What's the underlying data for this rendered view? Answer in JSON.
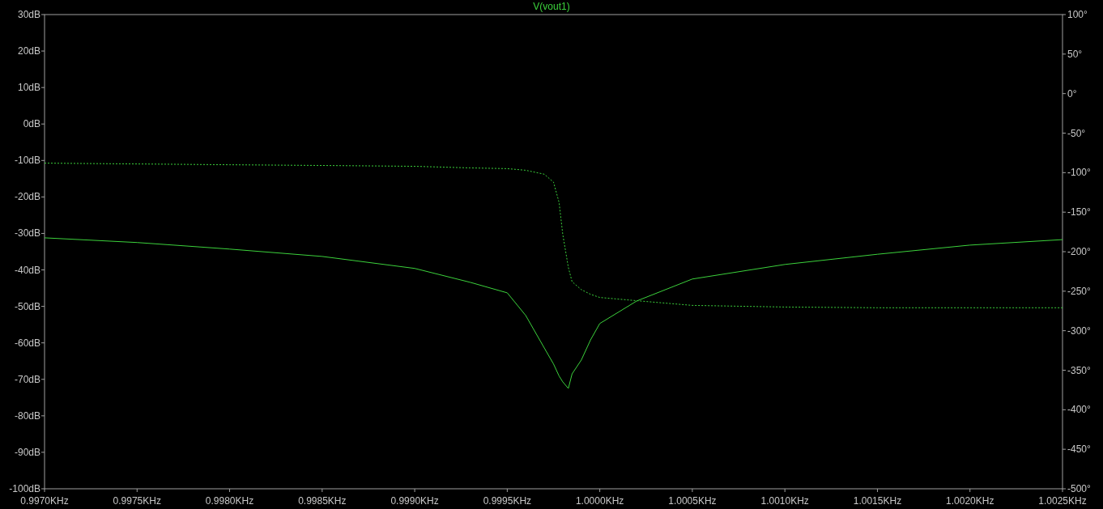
{
  "plot": {
    "chart_data": {
      "type": "line",
      "title": "V(vout1)",
      "x": [
        0.997,
        0.9975,
        0.998,
        0.9985,
        0.999,
        0.9993,
        0.9995,
        0.9996,
        0.9997,
        0.99975,
        0.99978,
        0.9998,
        0.99983,
        0.99985,
        0.9999,
        0.99995,
        1.0,
        1.0002,
        1.0005,
        1.001,
        1.0015,
        1.002,
        1.0025
      ],
      "series": [
        {
          "color": "#3cd23c",
          "line_style": "solid",
          "values": [
            -31.2,
            -32.5,
            -34.3,
            -36.3,
            -39.6,
            -43.4,
            -46.3,
            -52.5,
            -61.4,
            -65.8,
            -69.1,
            -70.7,
            -72.5,
            -68.5,
            -64.7,
            -59.2,
            -54.7,
            -48.5,
            -42.5,
            -38.5,
            -35.7,
            -33.2,
            -31.7
          ]
        },
        {
          "color": "#3cd23c",
          "axis": "y2",
          "line_style": "dashed",
          "values": [
            -88,
            -89,
            -90,
            -91,
            -92,
            -94,
            -95,
            -97,
            -102,
            -112,
            -138,
            -178,
            -220,
            -238,
            -248,
            -254,
            -258,
            -262,
            -268,
            -270,
            -271,
            -271,
            -271
          ]
        }
      ],
      "xlim": [
        0.997,
        1.0025
      ],
      "ylim": [
        -100,
        30
      ],
      "y2lim": [
        -500,
        100
      ],
      "xticks": [
        {
          "value": 0.997,
          "label": "0.9970KHz"
        },
        {
          "value": 0.9975,
          "label": "0.9975KHz"
        },
        {
          "value": 0.998,
          "label": "0.9980KHz"
        },
        {
          "value": 0.9985,
          "label": "0.9985KHz"
        },
        {
          "value": 0.999,
          "label": "0.9990KHz"
        },
        {
          "value": 0.9995,
          "label": "0.9995KHz"
        },
        {
          "value": 1.0,
          "label": "1.0000KHz"
        },
        {
          "value": 1.0005,
          "label": "1.0005KHz"
        },
        {
          "value": 1.001,
          "label": "1.0010KHz"
        },
        {
          "value": 1.0015,
          "label": "1.0015KHz"
        },
        {
          "value": 1.002,
          "label": "1.0020KHz"
        },
        {
          "value": 1.0025,
          "label": "1.0025KHz"
        }
      ],
      "yticks": [
        {
          "value": 30,
          "label": "30dB"
        },
        {
          "value": 20,
          "label": "20dB"
        },
        {
          "value": 10,
          "label": "10dB"
        },
        {
          "value": 0,
          "label": "0dB"
        },
        {
          "value": -10,
          "label": "-10dB"
        },
        {
          "value": -20,
          "label": "-20dB"
        },
        {
          "value": -30,
          "label": "-30dB"
        },
        {
          "value": -40,
          "label": "-40dB"
        },
        {
          "value": -50,
          "label": "-50dB"
        },
        {
          "value": -60,
          "label": "-60dB"
        },
        {
          "value": -70,
          "label": "-70dB"
        },
        {
          "value": -80,
          "label": "-80dB"
        },
        {
          "value": -90,
          "label": "-90dB"
        },
        {
          "value": -100,
          "label": "-100dB"
        }
      ],
      "y2ticks": [
        {
          "value": 100,
          "label": "100°"
        },
        {
          "value": 50,
          "label": "50°"
        },
        {
          "value": 0,
          "label": "0°"
        },
        {
          "value": -50,
          "label": "-50°"
        },
        {
          "value": -100,
          "label": "-100°"
        },
        {
          "value": -150,
          "label": "-150°"
        },
        {
          "value": -200,
          "label": "-200°"
        },
        {
          "value": -250,
          "label": "-250°"
        },
        {
          "value": -300,
          "label": "-300°"
        },
        {
          "value": -350,
          "label": "-350°"
        },
        {
          "value": -400,
          "label": "-400°"
        },
        {
          "value": -450,
          "label": "-450°"
        },
        {
          "value": -500,
          "label": "-500°"
        }
      ]
    }
  }
}
